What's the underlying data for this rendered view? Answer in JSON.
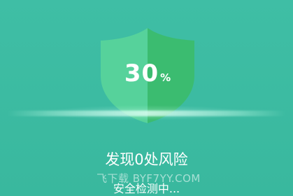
{
  "scan": {
    "progress_value": "30",
    "progress_unit": "%",
    "progress_fraction": 0.3,
    "risk_title": "发现0处风险",
    "status_text": "安全检测中..."
  },
  "watermark": {
    "text": "飞下载 BYF7YY.COM"
  },
  "colors": {
    "background": "#3dbba2",
    "shield_left": "#55d19a",
    "shield_right": "#3bbd6f",
    "text": "#ffffff"
  },
  "icons": {
    "shield": "shield-icon"
  }
}
